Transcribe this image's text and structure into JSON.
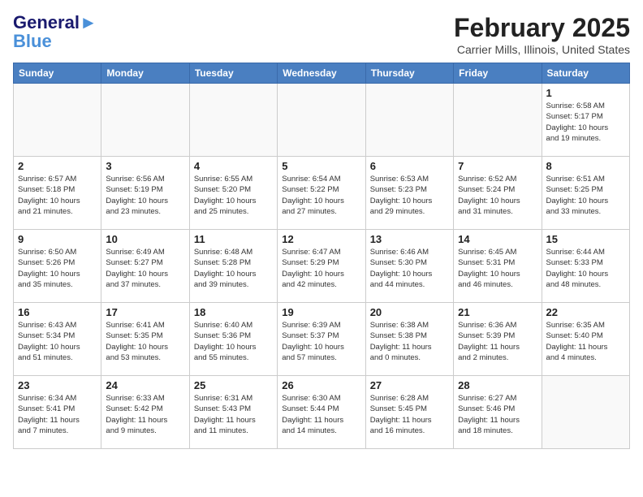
{
  "header": {
    "logo_line1": "General",
    "logo_line2": "Blue",
    "month": "February 2025",
    "location": "Carrier Mills, Illinois, United States"
  },
  "weekdays": [
    "Sunday",
    "Monday",
    "Tuesday",
    "Wednesday",
    "Thursday",
    "Friday",
    "Saturday"
  ],
  "weeks": [
    [
      {
        "day": "",
        "info": ""
      },
      {
        "day": "",
        "info": ""
      },
      {
        "day": "",
        "info": ""
      },
      {
        "day": "",
        "info": ""
      },
      {
        "day": "",
        "info": ""
      },
      {
        "day": "",
        "info": ""
      },
      {
        "day": "1",
        "info": "Sunrise: 6:58 AM\nSunset: 5:17 PM\nDaylight: 10 hours\nand 19 minutes."
      }
    ],
    [
      {
        "day": "2",
        "info": "Sunrise: 6:57 AM\nSunset: 5:18 PM\nDaylight: 10 hours\nand 21 minutes."
      },
      {
        "day": "3",
        "info": "Sunrise: 6:56 AM\nSunset: 5:19 PM\nDaylight: 10 hours\nand 23 minutes."
      },
      {
        "day": "4",
        "info": "Sunrise: 6:55 AM\nSunset: 5:20 PM\nDaylight: 10 hours\nand 25 minutes."
      },
      {
        "day": "5",
        "info": "Sunrise: 6:54 AM\nSunset: 5:22 PM\nDaylight: 10 hours\nand 27 minutes."
      },
      {
        "day": "6",
        "info": "Sunrise: 6:53 AM\nSunset: 5:23 PM\nDaylight: 10 hours\nand 29 minutes."
      },
      {
        "day": "7",
        "info": "Sunrise: 6:52 AM\nSunset: 5:24 PM\nDaylight: 10 hours\nand 31 minutes."
      },
      {
        "day": "8",
        "info": "Sunrise: 6:51 AM\nSunset: 5:25 PM\nDaylight: 10 hours\nand 33 minutes."
      }
    ],
    [
      {
        "day": "9",
        "info": "Sunrise: 6:50 AM\nSunset: 5:26 PM\nDaylight: 10 hours\nand 35 minutes."
      },
      {
        "day": "10",
        "info": "Sunrise: 6:49 AM\nSunset: 5:27 PM\nDaylight: 10 hours\nand 37 minutes."
      },
      {
        "day": "11",
        "info": "Sunrise: 6:48 AM\nSunset: 5:28 PM\nDaylight: 10 hours\nand 39 minutes."
      },
      {
        "day": "12",
        "info": "Sunrise: 6:47 AM\nSunset: 5:29 PM\nDaylight: 10 hours\nand 42 minutes."
      },
      {
        "day": "13",
        "info": "Sunrise: 6:46 AM\nSunset: 5:30 PM\nDaylight: 10 hours\nand 44 minutes."
      },
      {
        "day": "14",
        "info": "Sunrise: 6:45 AM\nSunset: 5:31 PM\nDaylight: 10 hours\nand 46 minutes."
      },
      {
        "day": "15",
        "info": "Sunrise: 6:44 AM\nSunset: 5:33 PM\nDaylight: 10 hours\nand 48 minutes."
      }
    ],
    [
      {
        "day": "16",
        "info": "Sunrise: 6:43 AM\nSunset: 5:34 PM\nDaylight: 10 hours\nand 51 minutes."
      },
      {
        "day": "17",
        "info": "Sunrise: 6:41 AM\nSunset: 5:35 PM\nDaylight: 10 hours\nand 53 minutes."
      },
      {
        "day": "18",
        "info": "Sunrise: 6:40 AM\nSunset: 5:36 PM\nDaylight: 10 hours\nand 55 minutes."
      },
      {
        "day": "19",
        "info": "Sunrise: 6:39 AM\nSunset: 5:37 PM\nDaylight: 10 hours\nand 57 minutes."
      },
      {
        "day": "20",
        "info": "Sunrise: 6:38 AM\nSunset: 5:38 PM\nDaylight: 11 hours\nand 0 minutes."
      },
      {
        "day": "21",
        "info": "Sunrise: 6:36 AM\nSunset: 5:39 PM\nDaylight: 11 hours\nand 2 minutes."
      },
      {
        "day": "22",
        "info": "Sunrise: 6:35 AM\nSunset: 5:40 PM\nDaylight: 11 hours\nand 4 minutes."
      }
    ],
    [
      {
        "day": "23",
        "info": "Sunrise: 6:34 AM\nSunset: 5:41 PM\nDaylight: 11 hours\nand 7 minutes."
      },
      {
        "day": "24",
        "info": "Sunrise: 6:33 AM\nSunset: 5:42 PM\nDaylight: 11 hours\nand 9 minutes."
      },
      {
        "day": "25",
        "info": "Sunrise: 6:31 AM\nSunset: 5:43 PM\nDaylight: 11 hours\nand 11 minutes."
      },
      {
        "day": "26",
        "info": "Sunrise: 6:30 AM\nSunset: 5:44 PM\nDaylight: 11 hours\nand 14 minutes."
      },
      {
        "day": "27",
        "info": "Sunrise: 6:28 AM\nSunset: 5:45 PM\nDaylight: 11 hours\nand 16 minutes."
      },
      {
        "day": "28",
        "info": "Sunrise: 6:27 AM\nSunset: 5:46 PM\nDaylight: 11 hours\nand 18 minutes."
      },
      {
        "day": "",
        "info": ""
      }
    ]
  ]
}
